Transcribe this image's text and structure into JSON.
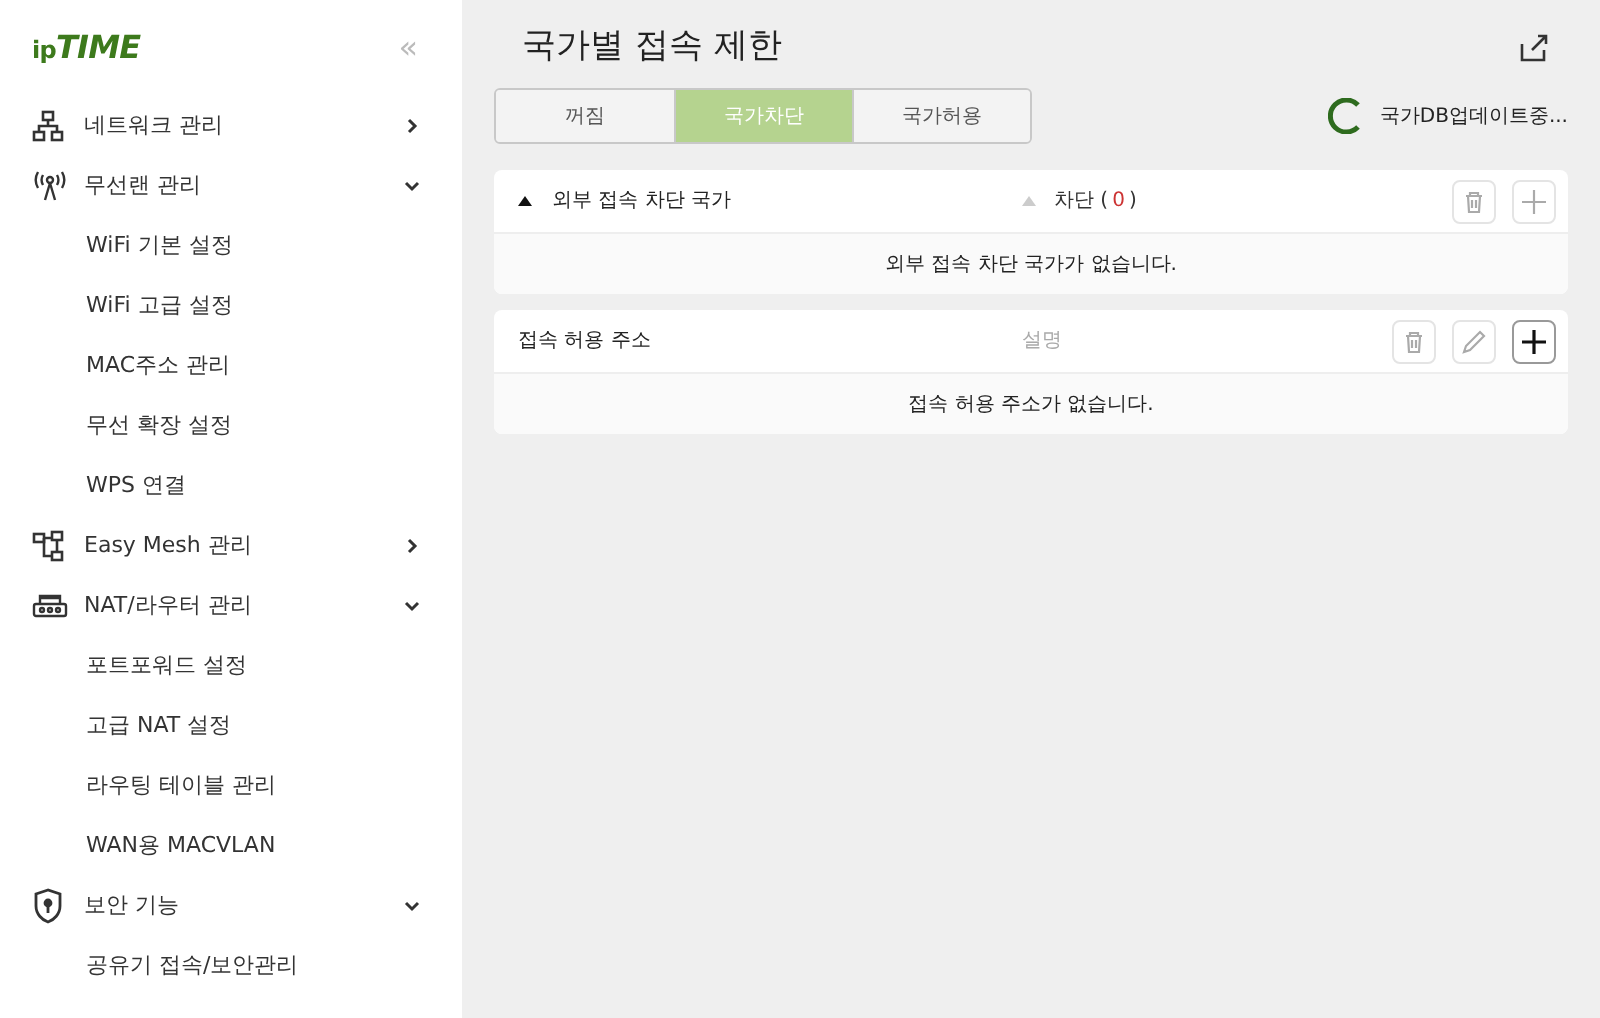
{
  "logo": {
    "prefix": "ip",
    "name": "TIME"
  },
  "collapse": "«",
  "sidebar": {
    "items": [
      {
        "label": "네트워크 관리",
        "expanded": false
      },
      {
        "label": "무선랜 관리",
        "expanded": true,
        "children": [
          {
            "label": "WiFi 기본 설정"
          },
          {
            "label": "WiFi 고급 설정"
          },
          {
            "label": "MAC주소 관리"
          },
          {
            "label": "무선 확장 설정"
          },
          {
            "label": "WPS 연결"
          }
        ]
      },
      {
        "label": "Easy Mesh 관리",
        "expanded": false
      },
      {
        "label": "NAT/라우터 관리",
        "expanded": true,
        "children": [
          {
            "label": "포트포워드 설정"
          },
          {
            "label": "고급 NAT 설정"
          },
          {
            "label": "라우팅 테이블 관리"
          },
          {
            "label": "WAN용 MACVLAN"
          }
        ]
      },
      {
        "label": "보안 기능",
        "expanded": true,
        "children": [
          {
            "label": "공유기 접속/보안관리"
          }
        ]
      }
    ]
  },
  "page": {
    "title": "국가별 접속 제한"
  },
  "tabs": [
    {
      "label": "꺼짐",
      "selected": false
    },
    {
      "label": "국가차단",
      "selected": true
    },
    {
      "label": "국가허용",
      "selected": false
    }
  ],
  "status": {
    "text": "국가DB업데이트중..."
  },
  "panels": [
    {
      "title": "외부 접속 차단 국가",
      "sortable": true,
      "column": {
        "label": "차단 (",
        "count": "0",
        "suffix": ")",
        "sortable": true
      },
      "buttons": [
        {
          "kind": "delete",
          "disabled": true
        },
        {
          "kind": "add",
          "disabled": true
        }
      ],
      "empty": "외부 접속 차단 국가가 없습니다."
    },
    {
      "title": "접속 허용 주소",
      "sortable": false,
      "column": {
        "label": "설명",
        "sortable": false
      },
      "buttons": [
        {
          "kind": "delete",
          "disabled": true
        },
        {
          "kind": "edit",
          "disabled": true
        },
        {
          "kind": "add",
          "disabled": false
        }
      ],
      "empty": "접속 허용 주소가 없습니다."
    }
  ]
}
